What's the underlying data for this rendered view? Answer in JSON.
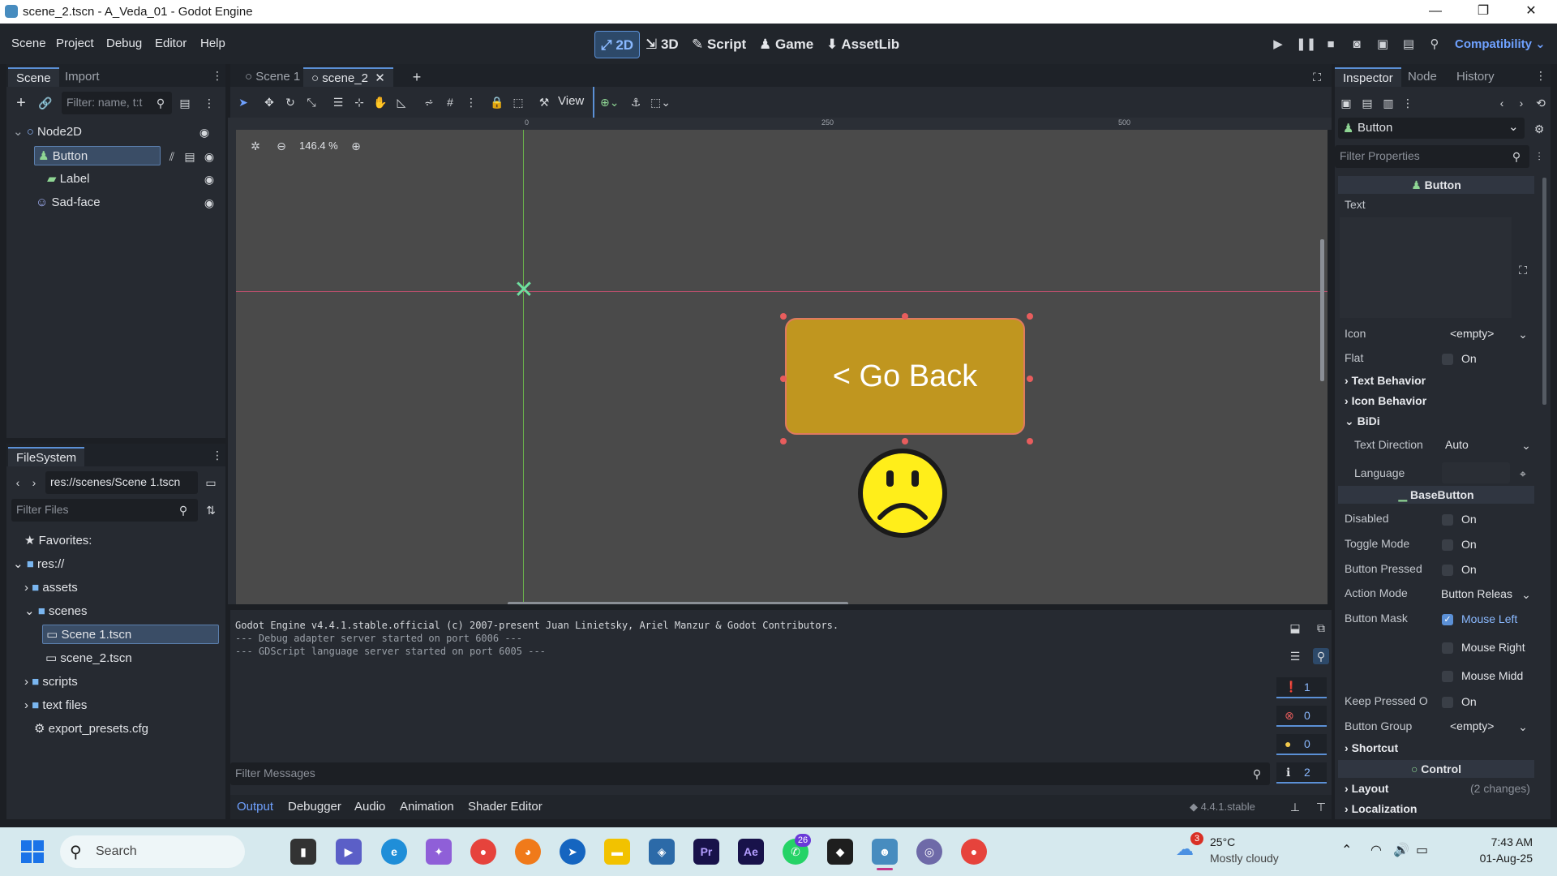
{
  "window": {
    "title": "scene_2.tscn - A_Veda_01 - Godot Engine"
  },
  "menu": [
    "Scene",
    "Project",
    "Debug",
    "Editor",
    "Help"
  ],
  "workspaces": [
    "2D",
    "3D",
    "Script",
    "Game",
    "AssetLib"
  ],
  "renderer": "Compatibility",
  "scene_dock": {
    "tabs": [
      "Scene",
      "Import"
    ],
    "filter_placeholder": "Filter: name, t:t",
    "nodes": [
      {
        "label": "Node2D",
        "icon": "node2d-icon"
      },
      {
        "label": "Button",
        "icon": "button-icon"
      },
      {
        "label": "Label",
        "icon": "label-icon"
      },
      {
        "label": "Sad-face",
        "icon": "sprite-icon"
      }
    ]
  },
  "filesystem": {
    "tab": "FileSystem",
    "path": "res://scenes/Scene 1.tscn",
    "filter_placeholder": "Filter Files",
    "items": [
      "Favorites:",
      "res://",
      "assets",
      "scenes",
      "Scene 1.tscn",
      "scene_2.tscn",
      "scripts",
      "text files",
      "export_presets.cfg"
    ]
  },
  "editor_tabs": [
    "Scene 1",
    "scene_2"
  ],
  "toolbar": {
    "view_label": "View"
  },
  "viewport": {
    "zoom": "146.4 %",
    "ruler": [
      "0",
      "250",
      "500"
    ],
    "button_text": "< Go Back"
  },
  "output": {
    "lines": [
      "Godot Engine v4.4.1.stable.official (c) 2007-present Juan Linietsky, Ariel Manzur & Godot Contributors.",
      "--- Debug adapter server started on port 6006 ---",
      "--- GDScript language server started on port 6005 ---"
    ],
    "counts": [
      "1",
      "0",
      "0",
      "2"
    ],
    "filter_placeholder": "Filter Messages",
    "bottom_tabs": [
      "Output",
      "Debugger",
      "Audio",
      "Animation",
      "Shader Editor"
    ],
    "version": "4.4.1.stable"
  },
  "inspector": {
    "tabs": [
      "Inspector",
      "Node",
      "History"
    ],
    "node": "Button",
    "filter_placeholder": "Filter Properties",
    "category_button": "Button",
    "text_label": "Text",
    "icon_label": "Icon",
    "icon_value": "<empty>",
    "flat_label": "Flat",
    "on": "On",
    "text_behavior": "Text Behavior",
    "icon_behavior": "Icon Behavior",
    "bidi": "BiDi",
    "text_direction_label": "Text Direction",
    "text_direction_value": "Auto",
    "language_label": "Language",
    "category_basebutton": "BaseButton",
    "disabled_label": "Disabled",
    "toggle_label": "Toggle Mode",
    "pressed_label": "Button Pressed",
    "action_label": "Action Mode",
    "action_value": "Button Releas",
    "mask_label": "Button Mask",
    "mask_left": "Mouse Left",
    "mask_right": "Mouse Right",
    "mask_middle": "Mouse Midd",
    "keep_label": "Keep Pressed O",
    "group_label": "Button Group",
    "group_value": "<empty>",
    "shortcut": "Shortcut",
    "category_control": "Control",
    "layout": "Layout",
    "layout_changes": "(2 changes)",
    "localization": "Localization"
  },
  "taskbar": {
    "search": "Search",
    "weather_temp": "25°C",
    "weather_desc": "Mostly cloudy",
    "weather_badge": "3",
    "time": "7:43 AM",
    "date": "01-Aug-25",
    "whatsapp_badge": "26"
  }
}
